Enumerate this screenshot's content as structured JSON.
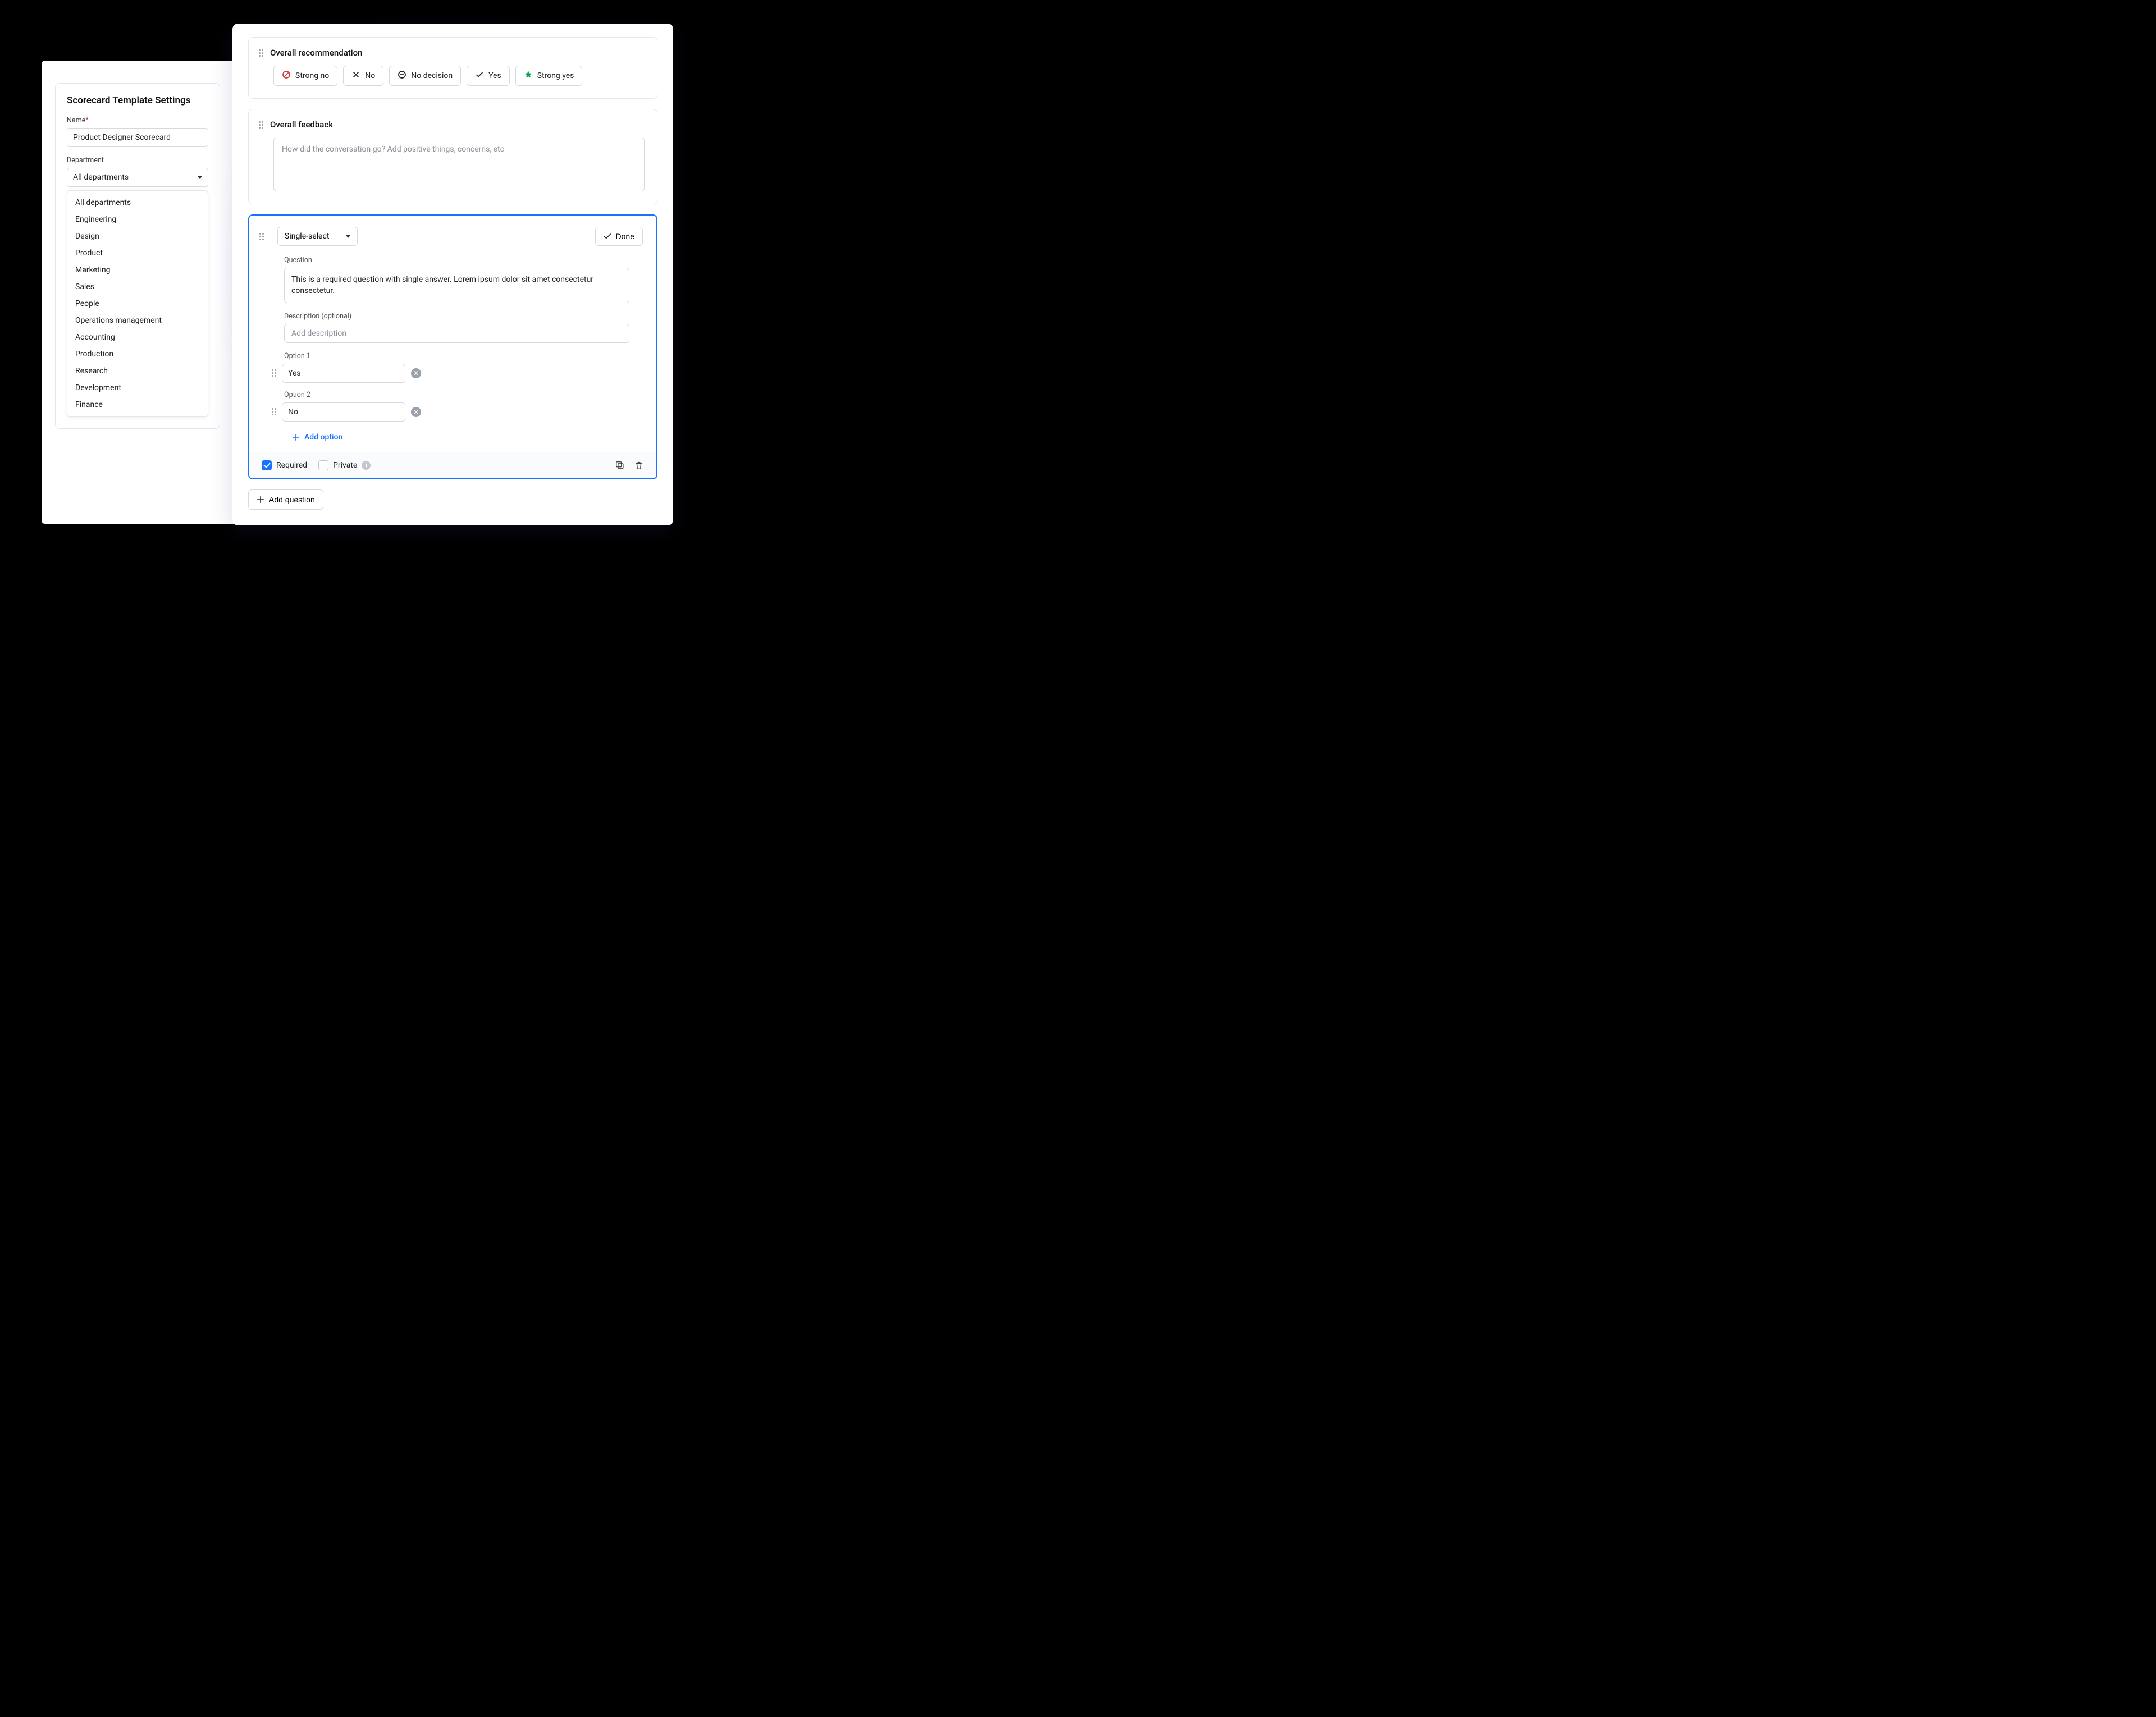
{
  "settings": {
    "title": "Scorecard Template Settings",
    "name_label": "Name",
    "name_value": "Product Designer Scorecard",
    "dept_label": "Department",
    "dept_selected": "All departments",
    "dept_options": [
      "All departments",
      "Engineering",
      "Design",
      "Product",
      "Marketing",
      "Sales",
      "People",
      "Operations management",
      "Accounting",
      "Production",
      "Research",
      "Development",
      "Finance"
    ]
  },
  "recommendation": {
    "title": "Overall recommendation",
    "chips": [
      {
        "key": "strong-no",
        "label": "Strong no",
        "icon": "ban",
        "color": "#d43b3b"
      },
      {
        "key": "no",
        "label": "No",
        "icon": "close",
        "color": "#222"
      },
      {
        "key": "no-decision",
        "label": "No decision",
        "icon": "minus",
        "color": "#222"
      },
      {
        "key": "yes",
        "label": "Yes",
        "icon": "check",
        "color": "#222"
      },
      {
        "key": "strong-yes",
        "label": "Strong yes",
        "icon": "star",
        "color": "#0aa84f"
      }
    ]
  },
  "feedback": {
    "title": "Overall feedback",
    "placeholder": "How did the conversation go? Add positive things, concerns, etc"
  },
  "question": {
    "type_label": "Single-select",
    "done_label": "Done",
    "question_label": "Question",
    "question_value": "This is a required question with single answer. Lorem ipsum dolor sit amet consectetur consectetur.",
    "description_label": "Description (optional)",
    "description_placeholder": "Add description",
    "options": [
      {
        "label": "Option 1",
        "value": "Yes"
      },
      {
        "label": "Option 2",
        "value": "No"
      }
    ],
    "add_option_label": "Add option",
    "required_label": "Required",
    "required_checked": true,
    "private_label": "Private",
    "private_checked": false
  },
  "add_question_label": "Add question"
}
